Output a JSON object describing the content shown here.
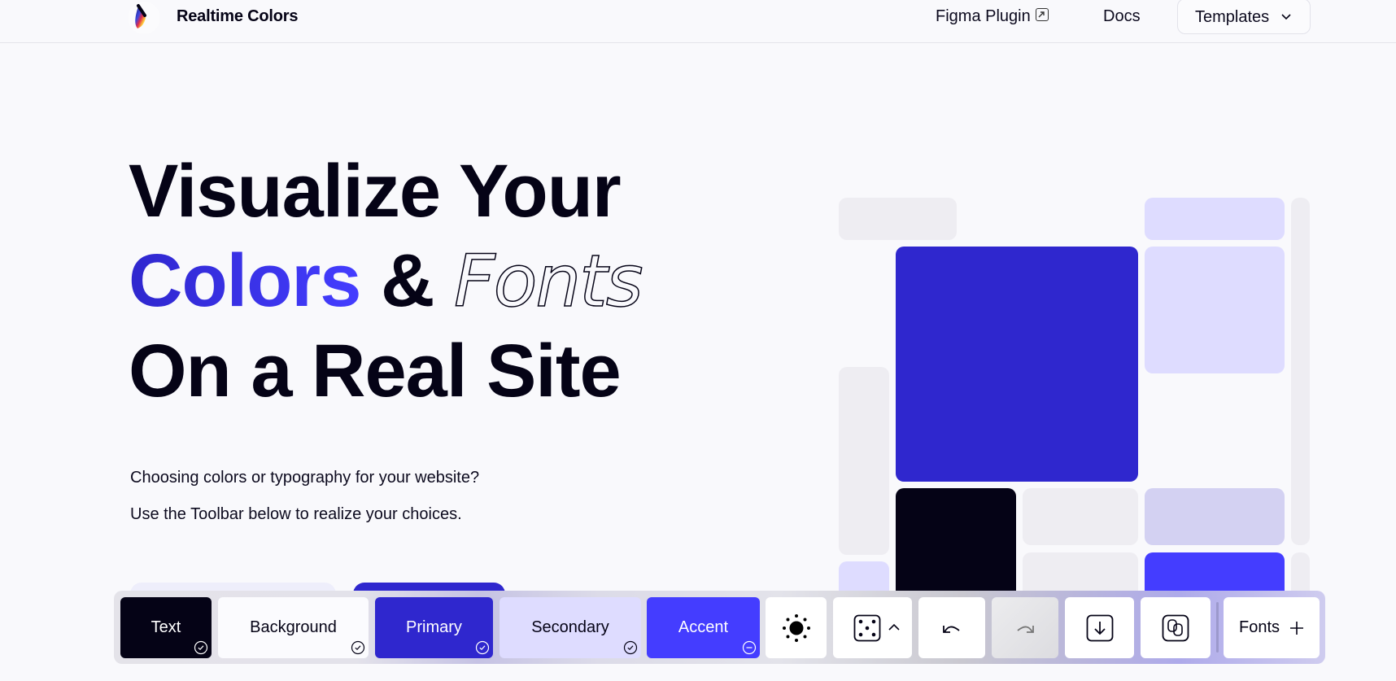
{
  "nav": {
    "brand": "Realtime Colors",
    "logo_icon": "droplet-gradient-logo-icon",
    "links": [
      {
        "label": "Figma Plugin",
        "icon": "external-link-icon"
      },
      {
        "label": "Docs"
      }
    ],
    "templates": {
      "label": "Templates",
      "icon": "chevron-down-icon"
    }
  },
  "hero": {
    "line1": "Visualize Your",
    "line2_colored": "Colors",
    "line2_amp": "&",
    "line2_outlined": "Fonts",
    "line3": "On a Real Site",
    "para1": "Choosing colors or typography for your website?",
    "para2": "Use the Toolbar below to realize your choices."
  },
  "colors": {
    "text": "#050316",
    "background": "#fbfbfe",
    "primary": "#2f27ce",
    "secondary": "#dedcff",
    "accent": "#443dff"
  },
  "toolbar": {
    "swatches": [
      {
        "label": "Text",
        "status": "check-circle-icon"
      },
      {
        "label": "Background",
        "status": "check-circle-icon"
      },
      {
        "label": "Primary",
        "status": "check-circle-icon"
      },
      {
        "label": "Secondary",
        "status": "check-circle-icon"
      },
      {
        "label": "Accent",
        "status": "minus-circle-icon"
      }
    ],
    "theme_toggle_icon": "sun-icon",
    "randomize_icon": "dice-five-icon",
    "randomize_options_icon": "chevron-up-icon",
    "undo_icon": "undo-icon",
    "redo_icon": "redo-icon",
    "export_icon": "download-icon",
    "share_icon": "link-icon",
    "fonts_label": "Fonts",
    "fonts_icon": "plus-icon"
  }
}
